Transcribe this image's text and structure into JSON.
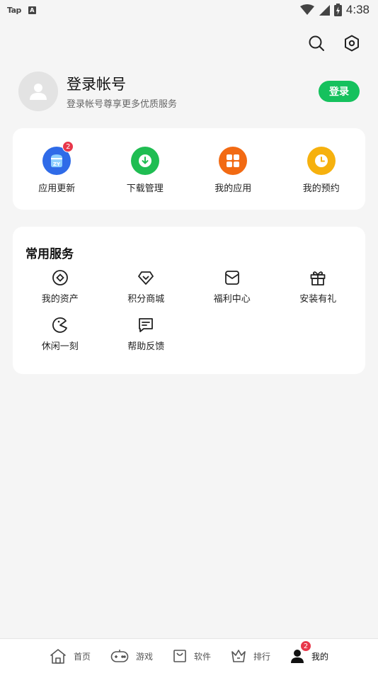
{
  "status_bar": {
    "left_app": "Tap",
    "left_icon_letter": "A",
    "time": "4:38"
  },
  "profile": {
    "title": "登录帐号",
    "subtitle": "登录帐号尊享更多优质服务",
    "login_label": "登录"
  },
  "apps": [
    {
      "label": "应用更新",
      "icon": "app-update-icon",
      "color": "#2f6be8",
      "badge": "2"
    },
    {
      "label": "下载管理",
      "icon": "download-icon",
      "color": "#1fbd52",
      "badge": ""
    },
    {
      "label": "我的应用",
      "icon": "my-apps-icon",
      "color": "#f26a13",
      "badge": ""
    },
    {
      "label": "我的预约",
      "icon": "reservation-icon",
      "color": "#f6b10e",
      "badge": ""
    }
  ],
  "services": {
    "title": "常用服务",
    "items": [
      {
        "label": "我的资产",
        "icon": "assets-icon"
      },
      {
        "label": "积分商城",
        "icon": "points-mall-icon"
      },
      {
        "label": "福利中心",
        "icon": "welfare-icon"
      },
      {
        "label": "安装有礼",
        "icon": "gift-icon"
      },
      {
        "label": "休闲一刻",
        "icon": "casual-game-icon"
      },
      {
        "label": "帮助反馈",
        "icon": "feedback-icon"
      }
    ]
  },
  "bottom_nav": [
    {
      "label": "首页",
      "icon": "home-icon",
      "active": false,
      "badge": ""
    },
    {
      "label": "游戏",
      "icon": "gamepad-icon",
      "active": false,
      "badge": ""
    },
    {
      "label": "软件",
      "icon": "software-bag-icon",
      "active": false,
      "badge": ""
    },
    {
      "label": "排行",
      "icon": "crown-icon",
      "active": false,
      "badge": ""
    },
    {
      "label": "我的",
      "icon": "profile-icon",
      "active": true,
      "badge": "2"
    }
  ]
}
